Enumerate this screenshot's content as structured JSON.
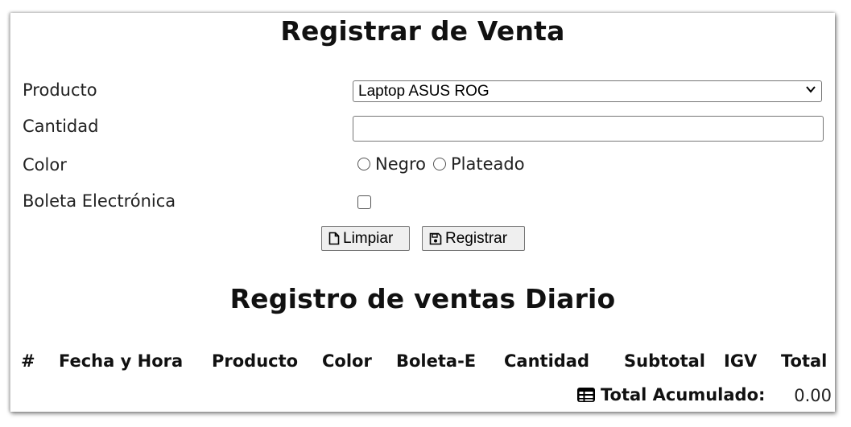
{
  "form": {
    "title": "Registrar de Venta",
    "producto_label": "Producto",
    "producto_value": "Laptop ASUS ROG",
    "cantidad_label": "Cantidad",
    "cantidad_value": "",
    "color_label": "Color",
    "color_options": [
      "Negro",
      "Plateado"
    ],
    "boleta_label": "Boleta Electrónica",
    "boleta_checked": false,
    "limpiar_label": "Limpiar",
    "limpiar_icon": "file-icon",
    "registrar_label": "Registrar",
    "registrar_icon": "save-icon"
  },
  "table": {
    "title": "Registro de ventas Diario",
    "headers": [
      "#",
      "Fecha y Hora",
      "Producto",
      "Color",
      "Boleta-E",
      "Cantidad",
      "Subtotal",
      "IGV",
      "Total"
    ],
    "rows": [],
    "total_icon": "table-icon",
    "total_label": "Total Acumulado:",
    "total_value": "0.00"
  }
}
